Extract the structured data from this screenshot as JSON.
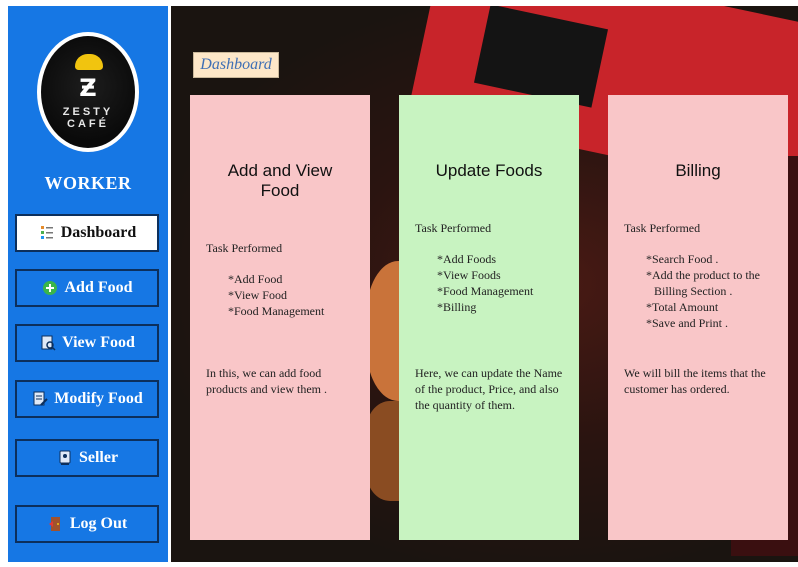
{
  "sidebar": {
    "logo_text": "ZESTY CAFÉ",
    "role": "WORKER",
    "items": [
      {
        "label": "Dashboard",
        "icon": "tree-list-icon"
      },
      {
        "label": "Add Food",
        "icon": "plus-circle-icon"
      },
      {
        "label": "View Food",
        "icon": "document-search-icon"
      },
      {
        "label": "Modify Food",
        "icon": "edit-document-icon"
      },
      {
        "label": "Seller",
        "icon": "seller-icon"
      },
      {
        "label": "Log Out",
        "icon": "exit-door-icon"
      }
    ],
    "active_item": "Dashboard"
  },
  "main": {
    "tag": "Dashboard",
    "cards": [
      {
        "title": "Add  and View Food",
        "section": "Task Performed",
        "tasks": [
          "*Add Food",
          "*View Food",
          "*Food Management"
        ],
        "description": "In this, we can add food products and view them ."
      },
      {
        "title": "Update Foods",
        "section": "Task Performed",
        "tasks": [
          "*Add Foods",
          "*View Foods",
          "*Food Management",
          "*Billing"
        ],
        "description": "Here, we can update the Name of the product, Price, and also the quantity of them."
      },
      {
        "title": "Billing",
        "section": "Task Performed",
        "tasks": [
          "*Search Food .",
          "*Add the product to the",
          "Billing Section .",
          "*Total Amount",
          "*Save and Print ."
        ],
        "description": "We will bill the items that the customer has ordered."
      }
    ]
  },
  "colors": {
    "sidebar": "#1677e4",
    "card_pink": "#f9c6c8",
    "card_green": "#c8f3c1",
    "tag_bg": "#fde7c8"
  }
}
